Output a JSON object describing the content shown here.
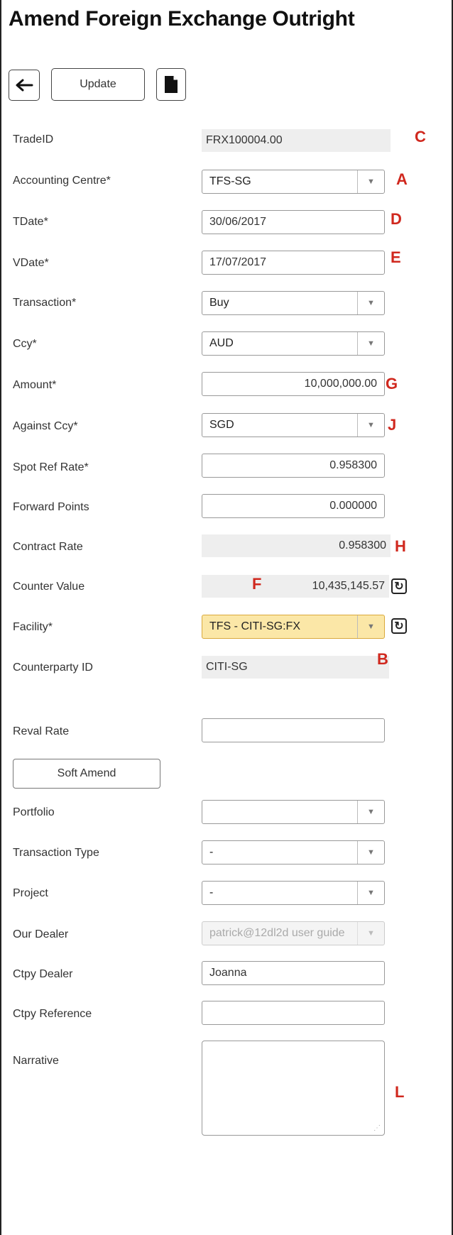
{
  "page": {
    "title": "Amend Foreign Exchange Outright"
  },
  "toolbar": {
    "update_label": "Update"
  },
  "fields": {
    "trade_id": {
      "label": "TradeID",
      "value": "FRX100004.00",
      "marker": "C"
    },
    "accounting_centre": {
      "label": "Accounting Centre*",
      "value": "TFS-SG",
      "marker": "A"
    },
    "tdate": {
      "label": "TDate*",
      "value": "30/06/2017",
      "marker": "D"
    },
    "vdate": {
      "label": "VDate*",
      "value": "17/07/2017",
      "marker": "E"
    },
    "transaction": {
      "label": "Transaction*",
      "value": "Buy"
    },
    "ccy": {
      "label": "Ccy*",
      "value": "AUD"
    },
    "amount": {
      "label": "Amount*",
      "value": "10,000,000.00",
      "marker": "G"
    },
    "against_ccy": {
      "label": "Against Ccy*",
      "value": "SGD",
      "marker": "J"
    },
    "spot_ref_rate": {
      "label": "Spot Ref Rate*",
      "value": "0.958300"
    },
    "forward_points": {
      "label": "Forward Points",
      "value": "0.000000"
    },
    "contract_rate": {
      "label": "Contract Rate",
      "value": "0.958300",
      "marker": "H"
    },
    "counter_value": {
      "label": "Counter Value",
      "value": "10,435,145.57",
      "marker": "F"
    },
    "facility": {
      "label": "Facility*",
      "value": "TFS - CITI-SG:FX"
    },
    "counterparty_id": {
      "label": "Counterparty ID",
      "value": "CITI-SG",
      "marker": "B"
    },
    "reval_rate": {
      "label": "Reval Rate",
      "value": ""
    },
    "soft_amend": {
      "label": "Soft Amend"
    },
    "portfolio": {
      "label": "Portfolio",
      "value": ""
    },
    "transaction_type": {
      "label": "Transaction Type",
      "value": "-"
    },
    "project": {
      "label": "Project",
      "value": "-"
    },
    "our_dealer": {
      "label": "Our Dealer",
      "value": "patrick@12dl2d user guide"
    },
    "ctpy_dealer": {
      "label": "Ctpy Dealer",
      "value": "Joanna"
    },
    "ctpy_reference": {
      "label": "Ctpy Reference",
      "value": ""
    },
    "narrative": {
      "label": "Narrative",
      "value": "",
      "marker": "L"
    }
  },
  "colors": {
    "marker": "#d0281e",
    "facility_bg": "#fbe7a7",
    "readonly_bg": "#eeeeee"
  }
}
